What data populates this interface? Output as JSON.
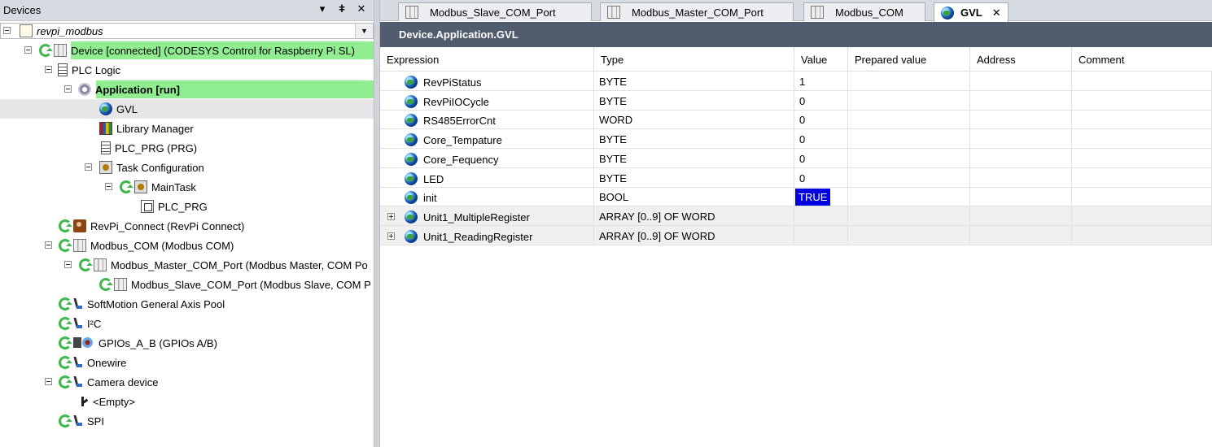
{
  "devices_panel": {
    "title": "Devices",
    "buttons": {
      "menu": "▾",
      "pin": "ǂ",
      "close": "✕"
    },
    "tree": [
      {
        "label": "revpi_modbus",
        "icon": "project-icon",
        "style": "italic"
      },
      {
        "label": "Device [connected] (CODESYS Control for Raspberry Pi SL)",
        "icon": "device-icon",
        "status": "connected"
      },
      {
        "label": "PLC Logic",
        "icon": "plc-logic-icon"
      },
      {
        "label": "Application [run]",
        "icon": "gear-icon",
        "style": "bold",
        "status": "run"
      },
      {
        "label": "GVL",
        "icon": "globe-icon",
        "selected": true
      },
      {
        "label": "Library Manager",
        "icon": "library-icon"
      },
      {
        "label": "PLC_PRG (PRG)",
        "icon": "document-icon"
      },
      {
        "label": "Task Configuration",
        "icon": "task-config-icon"
      },
      {
        "label": "MainTask",
        "icon": "task-icon"
      },
      {
        "label": "PLC_PRG",
        "icon": "program-call-icon"
      },
      {
        "label": "RevPi_Connect (RevPi Connect)",
        "icon": "revpi-icon"
      },
      {
        "label": "Modbus_COM (Modbus COM)",
        "icon": "device-icon"
      },
      {
        "label": "Modbus_Master_COM_Port (Modbus Master, COM Po",
        "icon": "device-icon"
      },
      {
        "label": "Modbus_Slave_COM_Port (Modbus Slave, COM P",
        "icon": "device-icon"
      },
      {
        "label": "SoftMotion General Axis Pool",
        "icon": "axis-icon"
      },
      {
        "label": "I²C",
        "icon": "axis-icon"
      },
      {
        "label": "GPIOs_A_B (GPIOs A/B)",
        "icon": "gpio-icon"
      },
      {
        "label": "Onewire",
        "icon": "axis-icon"
      },
      {
        "label": "Camera device",
        "icon": "axis-icon"
      },
      {
        "label": "<Empty>",
        "icon": "empty-slot-icon"
      },
      {
        "label": "SPI",
        "icon": "axis-icon"
      }
    ]
  },
  "editor": {
    "tabs": [
      {
        "label": "Modbus_Slave_COM_Port",
        "icon": "device-icon"
      },
      {
        "label": "Modbus_Master_COM_Port",
        "icon": "device-icon"
      },
      {
        "label": "Modbus_COM",
        "icon": "device-icon"
      },
      {
        "label": "GVL",
        "icon": "globe-icon",
        "active": true,
        "close": "✕"
      }
    ],
    "breadcrumb": "Device.Application.GVL",
    "columns": [
      "Expression",
      "Type",
      "Value",
      "Prepared value",
      "Address",
      "Comment"
    ],
    "rows": [
      {
        "expression": "RevPiStatus",
        "type": "BYTE",
        "value": "1",
        "prepared": "",
        "address": "",
        "comment": ""
      },
      {
        "expression": "RevPiIOCycle",
        "type": "BYTE",
        "value": "0",
        "prepared": "",
        "address": "",
        "comment": ""
      },
      {
        "expression": "RS485ErrorCnt",
        "type": "WORD",
        "value": "0",
        "prepared": "",
        "address": "",
        "comment": ""
      },
      {
        "expression": "Core_Tempature",
        "type": "BYTE",
        "value": "0",
        "prepared": "",
        "address": "",
        "comment": ""
      },
      {
        "expression": "Core_Fequency",
        "type": "BYTE",
        "value": "0",
        "prepared": "",
        "address": "",
        "comment": ""
      },
      {
        "expression": "LED",
        "type": "BYTE",
        "value": "0",
        "prepared": "",
        "address": "",
        "comment": ""
      },
      {
        "expression": "init",
        "type": "BOOL",
        "value": "TRUE",
        "prepared": "",
        "address": "",
        "comment": ""
      },
      {
        "expression": "Unit1_MultipleRegister",
        "type": "ARRAY [0..9] OF WORD",
        "value": "",
        "prepared": "",
        "address": "",
        "comment": "",
        "expandable": true
      },
      {
        "expression": "Unit1_ReadingRegister",
        "type": "ARRAY [0..9] OF WORD",
        "value": "",
        "prepared": "",
        "address": "",
        "comment": "",
        "expandable": true
      }
    ],
    "colors": {
      "connected_highlight": "#90ee90",
      "true_value_bg": "#0000e0",
      "breadcrumb_bg": "#515c6e"
    }
  }
}
